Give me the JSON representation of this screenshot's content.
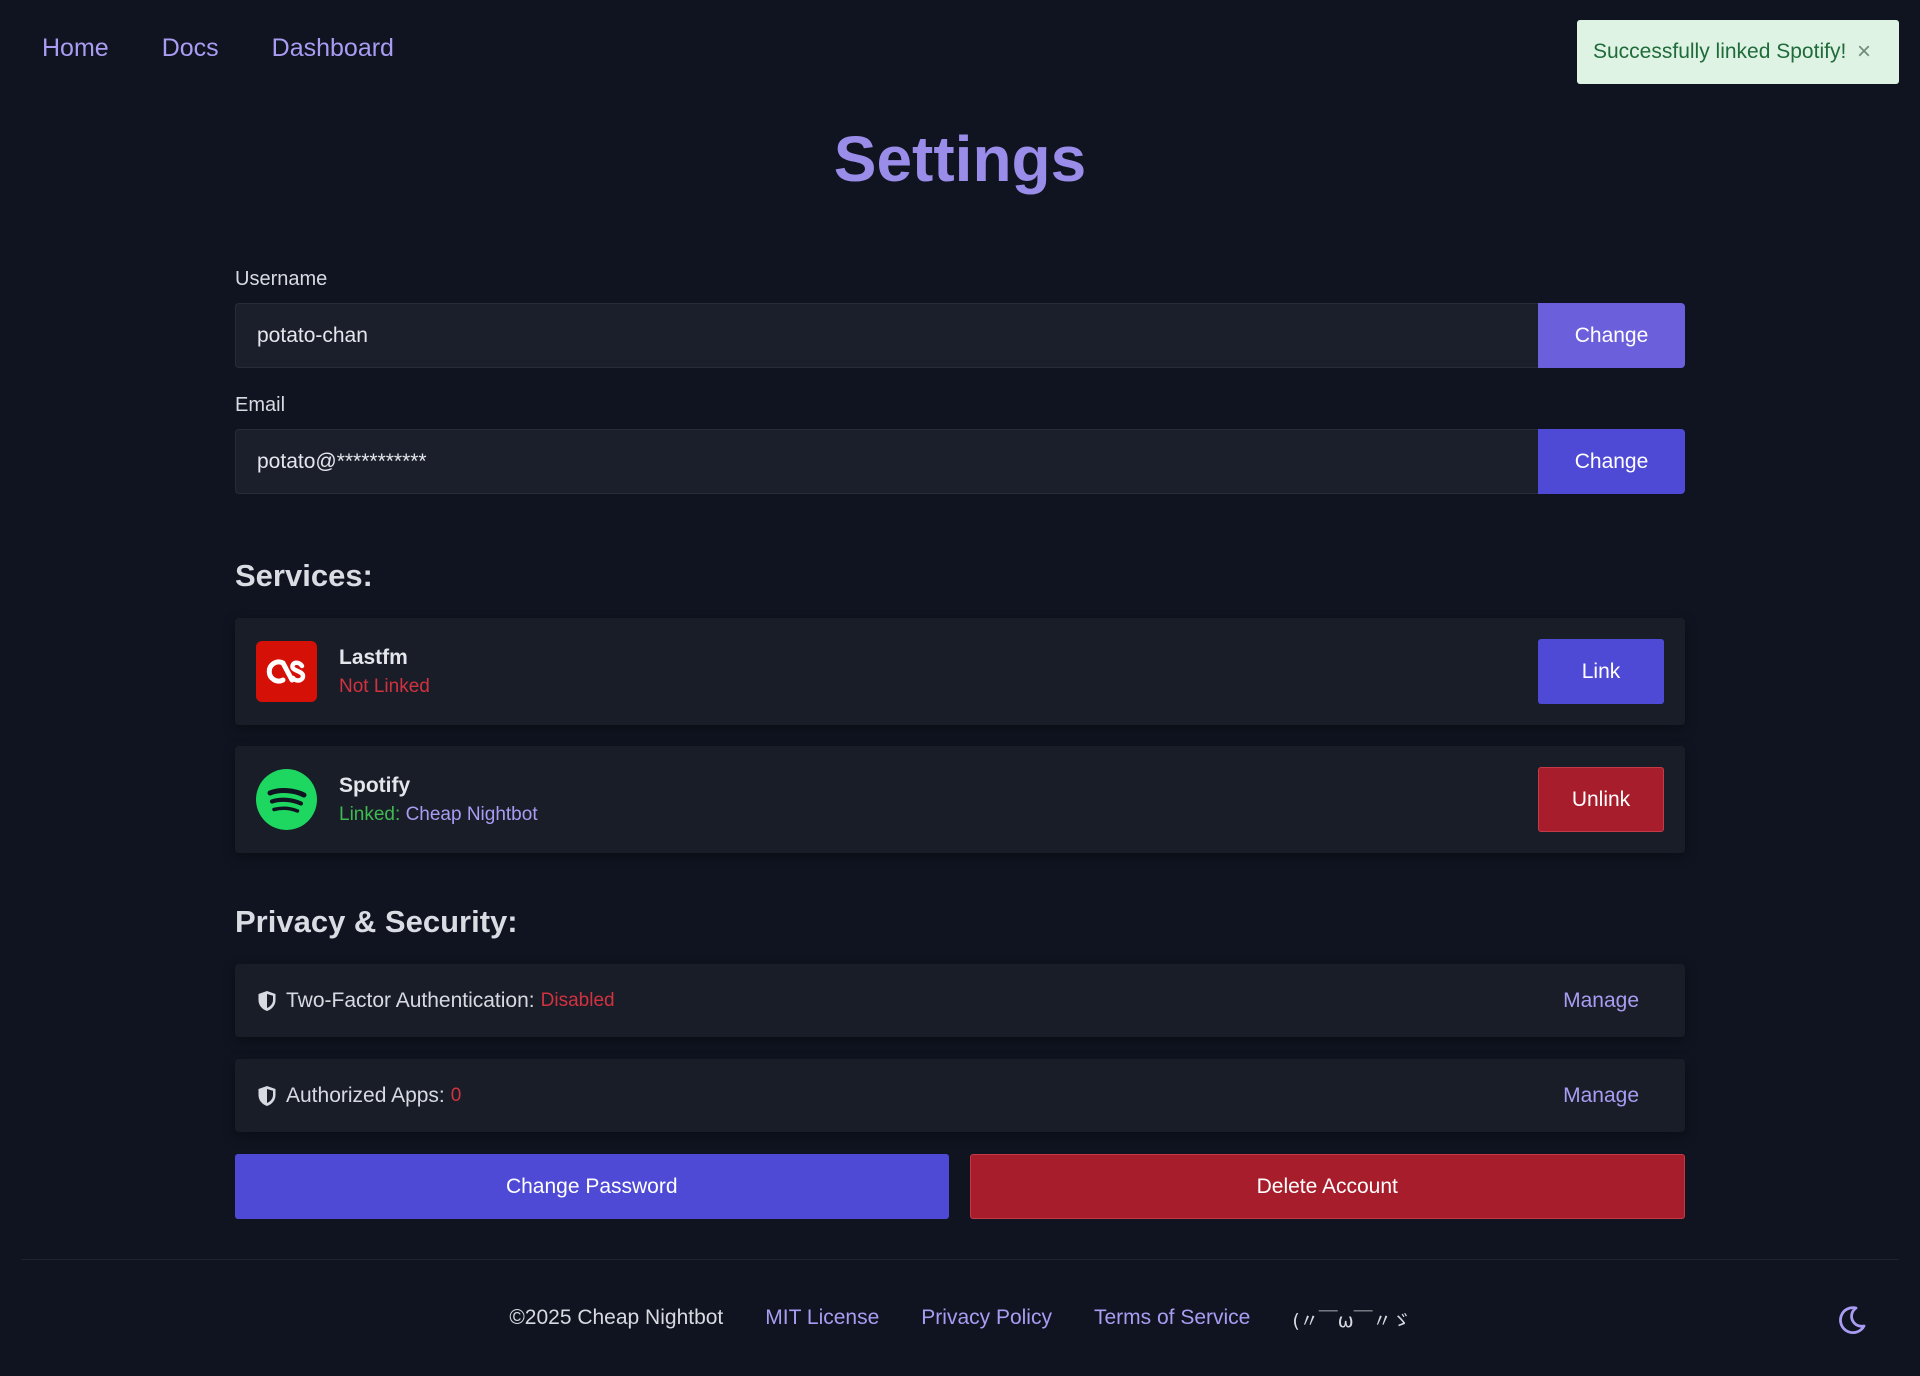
{
  "nav": {
    "home": "Home",
    "docs": "Docs",
    "dashboard": "Dashboard"
  },
  "toast": {
    "message": "Successfully linked Spotify!",
    "close": "×"
  },
  "page": {
    "title": "Settings"
  },
  "fields": {
    "username": {
      "label": "Username",
      "value": "potato-chan",
      "button": "Change"
    },
    "email": {
      "label": "Email",
      "value": "potato@***********",
      "button": "Change"
    }
  },
  "services": {
    "title": "Services:",
    "items": [
      {
        "name": "Lastfm",
        "status": "Not Linked",
        "button": "Link",
        "icon": "lastfm-icon"
      },
      {
        "name": "Spotify",
        "status_prefix": "Linked:",
        "account": "Cheap Nightbot",
        "button": "Unlink",
        "icon": "spotify-icon"
      }
    ]
  },
  "privacy": {
    "title": "Privacy & Security:",
    "items": [
      {
        "label": "Two-Factor Authentication:",
        "value": "Disabled",
        "action": "Manage",
        "icon": "shield-icon"
      },
      {
        "label": "Authorized Apps:",
        "value": "0",
        "action": "Manage",
        "icon": "shield-icon"
      }
    ]
  },
  "actions": {
    "change_password": "Change Password",
    "delete_account": "Delete Account"
  },
  "footer": {
    "copyright": "©2025 Cheap Nightbot",
    "license": "MIT License",
    "privacy": "Privacy Policy",
    "terms": "Terms of Service",
    "kaomoji": "(〃￣ω￣〃ゞ"
  },
  "theme": {
    "icon": "moon-icon"
  },
  "colors": {
    "background": "#0f1420",
    "accent": "#a99cf2",
    "primary_button": "#4f4ad6",
    "danger_button": "#a81d2b",
    "danger_text": "#d2323f",
    "success_text": "#3fb950",
    "toast_bg": "#dff3e4"
  }
}
